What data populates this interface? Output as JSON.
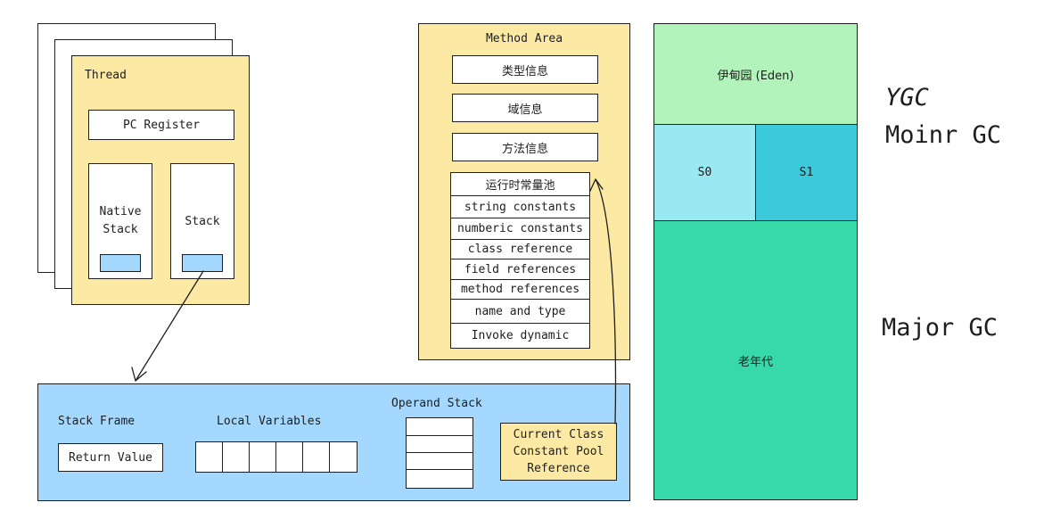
{
  "thread": {
    "title": "Thread",
    "pc_register": "PC Register",
    "native_stack": "Native\nStack",
    "stack": "Stack"
  },
  "method_area": {
    "title": "Method Area",
    "type_info": "类型信息",
    "field_info": "域信息",
    "method_info": "方法信息",
    "constant_pool": {
      "header": "运行时常量池",
      "rows": [
        "string constants",
        "numberic constants",
        "class reference",
        "field references",
        "method references",
        "name and type",
        "Invoke dynamic"
      ]
    }
  },
  "frame": {
    "stack_frame": "Stack Frame",
    "return_value": "Return Value",
    "local_variables": "Local Variables",
    "operand_stack": "Operand Stack",
    "current_class": "Current Class\nConstant Pool\nReference"
  },
  "heap": {
    "eden": "伊甸园 (Eden)",
    "s0": "S0",
    "s1": "S1",
    "old": "老年代"
  },
  "gc": {
    "ygc": "YGC",
    "minor": "Moinr GC",
    "major": "Major GC"
  },
  "colors": {
    "yellow": "#fce9a3",
    "light_blue": "#a5d8ff",
    "eden_green": "#b2f2bb",
    "s0_cyan": "#99e9f2",
    "s1_cyan": "#3bc9db",
    "old_green": "#38d9a9"
  }
}
